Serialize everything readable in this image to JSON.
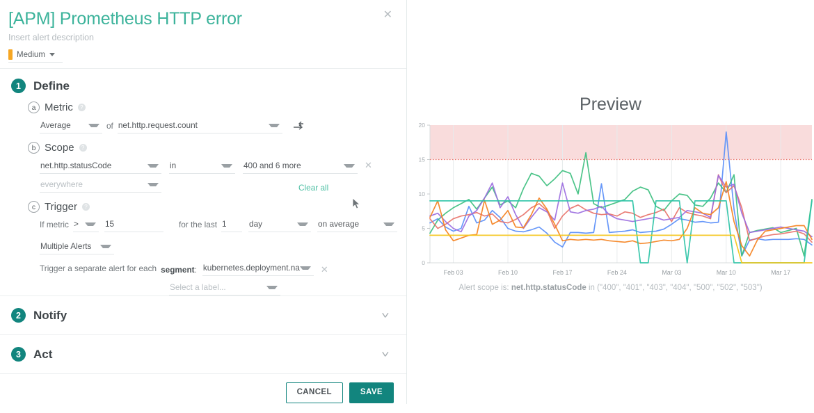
{
  "modal": {
    "title": "[APM] Prometheus HTTP error",
    "description": "Insert alert description",
    "close_icon": "close-icon",
    "priority": {
      "value": "Medium",
      "color": "#f6a623"
    }
  },
  "sections": [
    {
      "number": "1",
      "title": "Define"
    },
    {
      "number": "2",
      "title": "Notify"
    },
    {
      "number": "3",
      "title": "Act"
    }
  ],
  "define": {
    "metric": {
      "letter": "a",
      "title": "Metric",
      "aggregation": "Average",
      "of_label": "of",
      "metric_name": "net.http.request.count",
      "compare_icon": "compare-arrows-icon"
    },
    "scope": {
      "letter": "b",
      "title": "Scope",
      "key": "net.http.statusCode",
      "operator": "in",
      "values": "400 and 6 more",
      "remove_icon": "close-icon",
      "everywhere_placeholder": "everywhere",
      "clear_all": "Clear all"
    },
    "trigger": {
      "letter": "c",
      "title": "Trigger",
      "if_metric_label": "If metric",
      "comparator": ">",
      "threshold": "15",
      "for_the_last_label": "for the last",
      "duration_value": "1",
      "duration_unit": "day",
      "aggregation": "on average",
      "alert_type": "Multiple Alerts",
      "segment_label_prefix": "Trigger a separate alert for each",
      "segment_label_bold": "segment",
      "segment_label_suffix": ":",
      "segment_value": "kubernetes.deployment.name",
      "segment_remove_icon": "close-icon",
      "label_placeholder": "Select a label..."
    }
  },
  "footer": {
    "cancel": "CANCEL",
    "save": "SAVE"
  },
  "preview": {
    "title": "Preview",
    "caption_prefix": "Alert scope is:",
    "caption_scope": "net.http.statusCode",
    "caption_suffix": "in (\"400\", \"401\", \"403\", \"404\", \"500\", \"502\", \"503\")"
  },
  "chart_data": {
    "type": "line",
    "title": "Preview",
    "xlabel": "",
    "ylabel": "",
    "ylim": [
      0,
      20
    ],
    "yticks": [
      0,
      5,
      10,
      15,
      20
    ],
    "xticks": [
      "Feb 03",
      "Feb 10",
      "Feb 17",
      "Feb 24",
      "Mar 03",
      "Mar 10",
      "Mar 17"
    ],
    "xtick_indices": [
      3,
      10,
      17,
      24,
      31,
      38,
      45
    ],
    "x_count": 50,
    "grid": true,
    "legend": "none",
    "threshold": {
      "value": 15,
      "color": "#e8736a",
      "style": "dotted",
      "band_color": "#f9dcdc",
      "band_from": 15,
      "band_to": 20
    },
    "series": [
      {
        "name": "400",
        "color": "#5b8ff9",
        "values": [
          5.8,
          6.4,
          5.2,
          4.6,
          5.0,
          8.2,
          5.8,
          6.2,
          7.6,
          6.6,
          5.0,
          4.6,
          4.5,
          4.8,
          5.2,
          4.3,
          3.0,
          2.3,
          4.4,
          4.4,
          4.3,
          4.4,
          11.5,
          4.4,
          4.5,
          4.6,
          4.8,
          4.4,
          4.5,
          4.6,
          4.9,
          5.6,
          6.4,
          6.2,
          5.9,
          6.0,
          5.8,
          5.9,
          19.0,
          7.8,
          1.0,
          3.3,
          3.5,
          3.3,
          3.4,
          3.4,
          3.4,
          3.5,
          3.4,
          2.6
        ]
      },
      {
        "name": "401",
        "color": "#3dbf7f",
        "values": [
          4.3,
          6.2,
          7.2,
          8.0,
          8.6,
          9.2,
          7.8,
          9.4,
          11.0,
          8.4,
          9.0,
          8.0,
          10.8,
          13.0,
          12.6,
          11.2,
          12.2,
          13.4,
          13.0,
          10.0,
          16.0,
          8.6,
          8.0,
          8.4,
          8.8,
          9.2,
          10.4,
          11.0,
          10.6,
          8.2,
          7.6,
          9.0,
          10.0,
          9.8,
          8.4,
          8.2,
          9.4,
          11.6,
          10.2,
          12.8,
          1.0,
          4.4,
          4.7,
          4.9,
          5.1,
          4.4,
          4.7,
          5.0,
          1.0,
          9.2
        ]
      },
      {
        "name": "403",
        "color": "#e8736a",
        "values": [
          6.4,
          5.0,
          5.6,
          6.4,
          6.8,
          7.0,
          7.3,
          6.8,
          7.1,
          6.0,
          5.8,
          6.3,
          7.0,
          8.0,
          8.6,
          7.6,
          5.0,
          6.8,
          7.9,
          8.4,
          7.7,
          7.2,
          7.0,
          7.1,
          6.8,
          7.4,
          7.2,
          6.6,
          7.0,
          7.3,
          7.8,
          6.0,
          8.0,
          7.3,
          7.0,
          6.8,
          6.4,
          12.8,
          10.2,
          11.2,
          8.0,
          3.2,
          3.6,
          3.9,
          4.1,
          4.2,
          4.4,
          4.6,
          4.2,
          3.0
        ]
      },
      {
        "name": "404",
        "color": "#9b6ce0",
        "values": [
          6.8,
          7.2,
          6.0,
          5.0,
          4.5,
          6.8,
          7.6,
          9.4,
          11.6,
          8.0,
          9.6,
          7.0,
          5.0,
          6.6,
          8.0,
          7.4,
          6.2,
          11.6,
          7.4,
          7.2,
          7.6,
          7.8,
          8.2,
          7.0,
          6.4,
          6.2,
          6.0,
          6.2,
          6.4,
          6.6,
          6.2,
          6.4,
          6.6,
          7.6,
          7.4,
          7.2,
          6.6,
          12.7,
          11.0,
          11.4,
          7.2,
          4.4,
          4.6,
          4.8,
          5.0,
          5.2,
          5.0,
          4.8,
          4.6,
          3.8
        ]
      },
      {
        "name": "500",
        "color": "#f58220",
        "values": [
          6.6,
          9.0,
          4.8,
          3.2,
          3.6,
          4.0,
          4.1,
          9.1,
          5.6,
          6.2,
          7.6,
          5.2,
          5.1,
          7.0,
          9.4,
          7.8,
          5.6,
          3.2,
          3.4,
          3.3,
          3.4,
          3.3,
          3.4,
          3.2,
          3.1,
          3.0,
          3.2,
          2.8,
          2.9,
          3.1,
          3.3,
          3.2,
          3.4,
          5.0,
          8.0,
          7.2,
          7.0,
          8.0,
          11.8,
          6.0,
          2.5,
          1.0,
          3.3,
          4.6,
          4.8,
          5.0,
          5.2,
          5.4,
          5.4,
          3.4
        ]
      },
      {
        "name": "502",
        "color": "#2dc3a6",
        "constant": 9.0,
        "values": [
          9.0,
          9.0,
          9.0,
          9.0,
          9.0,
          9.0,
          9.0,
          9.0,
          9.0,
          9.0,
          9.0,
          9.0,
          9.0,
          9.0,
          9.0,
          9.0,
          9.0,
          9.0,
          9.0,
          9.0,
          9.0,
          9.0,
          9.0,
          9.0,
          9.0,
          9.0,
          9.0,
          0.0,
          0.0,
          9.0,
          9.0,
          9.0,
          9.0,
          0.0,
          9.0,
          9.0,
          9.0,
          9.0,
          9.0,
          0.0,
          0.0,
          0.0,
          0.0,
          0.0,
          0.0,
          0.0,
          0.0,
          0.0,
          0.0,
          9.0
        ]
      },
      {
        "name": "503",
        "color": "#f5c518",
        "constant": 4.0,
        "values": [
          4.0,
          4.0,
          4.0,
          4.0,
          4.0,
          4.0,
          4.0,
          4.0,
          4.0,
          4.0,
          4.0,
          4.0,
          4.0,
          4.0,
          4.0,
          4.0,
          4.0,
          4.0,
          4.0,
          4.0,
          4.0,
          4.0,
          4.0,
          4.0,
          4.0,
          4.0,
          4.0,
          4.0,
          4.0,
          4.0,
          4.0,
          4.0,
          4.0,
          4.0,
          4.0,
          4.0,
          4.0,
          4.0,
          4.0,
          4.0,
          0.0,
          0.0,
          0.0,
          0.0,
          0.0,
          0.0,
          0.0,
          0.0,
          0.0,
          0.0
        ]
      }
    ]
  }
}
